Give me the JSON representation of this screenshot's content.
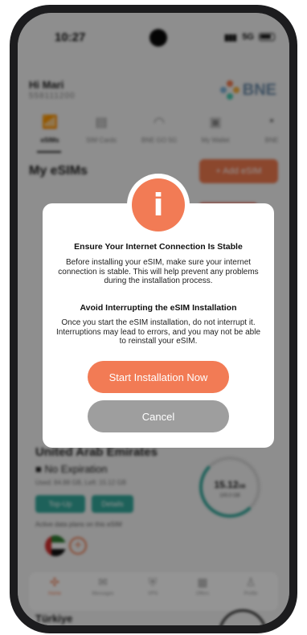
{
  "status_bar": {
    "time": "10:27",
    "signal": "▮▮▮",
    "network": "5G"
  },
  "header": {
    "greeting": "Hi Mari",
    "account": "558111200",
    "logo_text": "BNE"
  },
  "tabs": [
    {
      "label": "eSIMs",
      "icon": "signal-bars-icon",
      "glyph": "📶"
    },
    {
      "label": "SIM Cards",
      "icon": "sim-card-icon",
      "glyph": "▤"
    },
    {
      "label": "BNE GO 5G",
      "icon": "wifi-icon",
      "glyph": "◠"
    },
    {
      "label": "My Wallet",
      "icon": "wallet-icon",
      "glyph": "▣"
    },
    {
      "label": "BNE",
      "icon": "more-icon",
      "glyph": "▪"
    }
  ],
  "main": {
    "section_title": "My eSIMs",
    "add_button": "+ Add eSIM",
    "card": {
      "country": "United Arab Emirates",
      "expiry": "No Expiration",
      "usage": "Used: 84.88 GB, Left: 15.12 GB",
      "topup_label": "Top-Up",
      "details_label": "Details",
      "remaining": "15.12",
      "remaining_unit": "GB",
      "total": "100.0 GB",
      "active_plans_label": "Active data plans on this eSIM"
    },
    "next_card_country": "Türkiye"
  },
  "bottom_nav": [
    {
      "label": "Home",
      "glyph": "✣"
    },
    {
      "label": "Messages",
      "glyph": "✉"
    },
    {
      "label": "VPN",
      "glyph": "⛨"
    },
    {
      "label": "Offers",
      "glyph": "▦"
    },
    {
      "label": "Profile",
      "glyph": "♙"
    }
  ],
  "modal": {
    "icon_glyph": "i",
    "heading_1": "Ensure Your Internet Connection Is Stable",
    "body_1": "Before installing your eSIM, make sure your internet connection is stable. This will help prevent any problems during the installation process.",
    "heading_2": "Avoid Interrupting the eSIM Installation",
    "body_2": "Once you start the eSIM installation, do not interrupt it. Interruptions may lead to errors, and you may not be able to reinstall your eSIM.",
    "primary_button": "Start Installation Now",
    "secondary_button": "Cancel"
  },
  "colors": {
    "accent": "#f27b55",
    "cancel": "#9e9e9e",
    "teal": "#34a89b"
  }
}
